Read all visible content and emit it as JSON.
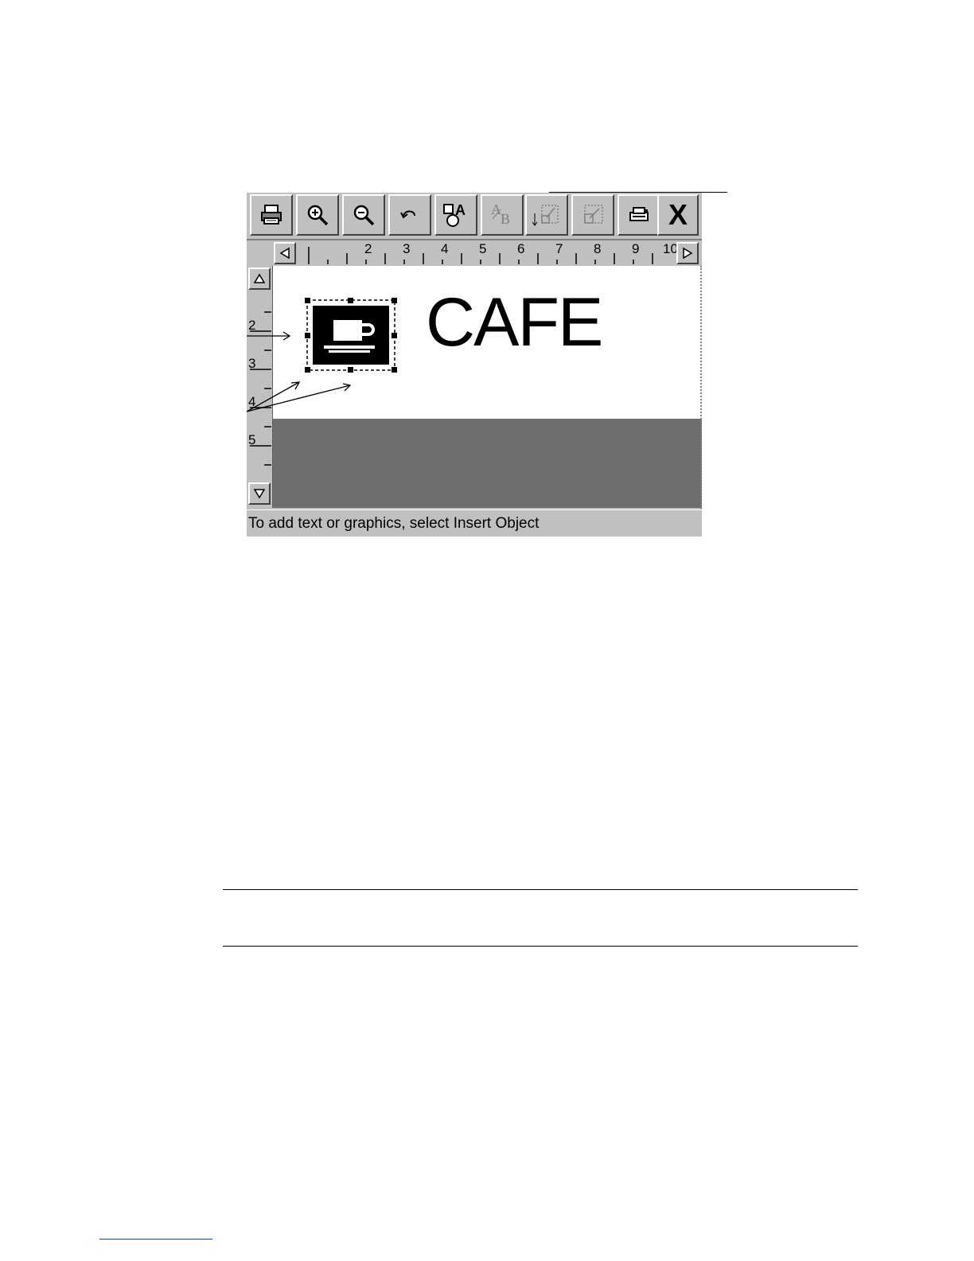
{
  "toolbar": {
    "buttons": [
      {
        "name": "print-button",
        "icon": "printer-icon"
      },
      {
        "name": "zoom-in-button",
        "icon": "zoom-in-icon"
      },
      {
        "name": "zoom-out-button",
        "icon": "zoom-out-icon"
      },
      {
        "name": "undo-button",
        "icon": "undo-icon"
      },
      {
        "name": "insert-object-button",
        "icon": "insert-object-icon"
      },
      {
        "name": "text-format-button",
        "icon": "text-ab-icon"
      },
      {
        "name": "align-button",
        "icon": "align-frame-icon"
      },
      {
        "name": "resize-button",
        "icon": "resize-frame-icon"
      },
      {
        "name": "setup-button",
        "icon": "device-icon"
      },
      {
        "name": "close-button",
        "icon": "close-icon",
        "label": "X"
      }
    ]
  },
  "h_ruler": {
    "numbers": [
      "2",
      "3",
      "4",
      "5",
      "6",
      "7",
      "8",
      "9",
      "10"
    ]
  },
  "v_ruler": {
    "numbers": [
      "2",
      "3",
      "4",
      "5"
    ]
  },
  "canvas": {
    "text": "CAFE",
    "graphic": "coffee-cup-icon"
  },
  "status_bar": {
    "message": "To add text or graphics, select Insert Object"
  }
}
